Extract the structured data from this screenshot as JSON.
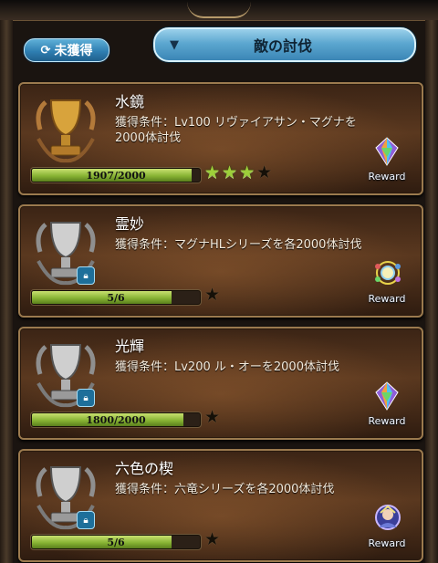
{
  "filter": {
    "label": "未獲得"
  },
  "dropdown": {
    "label": "敵の討伐"
  },
  "achievements": [
    {
      "title": "水鏡",
      "condition": "獲得条件：Lv100 リヴァイアサン・マグナを2000体討伐",
      "progress_text": "1907/2000",
      "progress": 0.9535,
      "stars_earned": 3,
      "stars_total": 4,
      "trophy": "gold-trophy-icon",
      "locked": false,
      "reward_icon": "rainbow-crystal-icon",
      "reward_label": "Reward"
    },
    {
      "title": "霊妙",
      "condition": "獲得条件：マグナHLシリーズを各2000体討伐",
      "progress_text": "5/6",
      "progress": 0.833,
      "stars_earned": 0,
      "stars_total": 1,
      "trophy": "silver-trophy-icon",
      "locked": true,
      "reward_icon": "summon-stone-icon",
      "reward_label": "Reward"
    },
    {
      "title": "光輝",
      "condition": "獲得条件：Lv200 ル・オーを2000体討伐",
      "progress_text": "1800/2000",
      "progress": 0.9,
      "stars_earned": 0,
      "stars_total": 1,
      "trophy": "silver-trophy-icon",
      "locked": true,
      "reward_icon": "rainbow-crystal-icon",
      "reward_label": "Reward"
    },
    {
      "title": "六色の楔",
      "condition": "獲得条件：六竜シリーズを各2000体討伐",
      "progress_text": "5/6",
      "progress": 0.833,
      "stars_earned": 0,
      "stars_total": 1,
      "trophy": "silver-trophy-icon",
      "locked": true,
      "reward_icon": "character-portrait-icon",
      "reward_label": "Reward"
    }
  ],
  "colors": {
    "accent_blue": "#5ca7d0",
    "progress_green": "#88b434",
    "star_green": "#9ecf3a"
  }
}
